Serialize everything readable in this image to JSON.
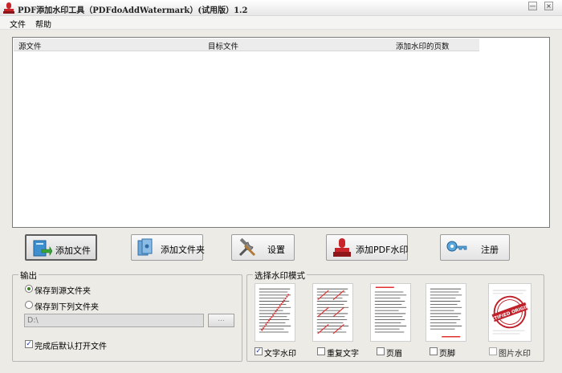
{
  "window": {
    "title": "PDF添加水印工具（PDFdoAddWatermark）(试用版）1.2",
    "minimize_glyph": "—",
    "close_glyph": "×"
  },
  "menu": [
    "文件",
    "帮助"
  ],
  "table": {
    "columns": [
      "源文件",
      "目标文件",
      "添加水印的页数"
    ],
    "rows": []
  },
  "toolbar": {
    "add_file": "添加文件",
    "add_folder": "添加文件夹",
    "settings": "设置",
    "add_watermark": "添加PDF水印",
    "register": "注册"
  },
  "output": {
    "title": "输出",
    "save_source": "保存到源文件夹",
    "save_below": "保存到下列文件夹",
    "path_value": "D:\\",
    "browse_label": "...",
    "open_after": "完成后默认打开文件"
  },
  "mode": {
    "title": "选择水印模式",
    "options": [
      {
        "label": "文字水印",
        "checked": true
      },
      {
        "label": "重复文字",
        "checked": false
      },
      {
        "label": "页眉",
        "checked": false
      },
      {
        "label": "页脚",
        "checked": false
      },
      {
        "label": "图片水印",
        "checked": false
      }
    ],
    "stamp_text": "CERTIFIED ORIGINAL"
  },
  "colors": {
    "accent_red": "#c8242a",
    "icon_blue": "#2f74b8",
    "stamp_red": "#c0202a"
  }
}
